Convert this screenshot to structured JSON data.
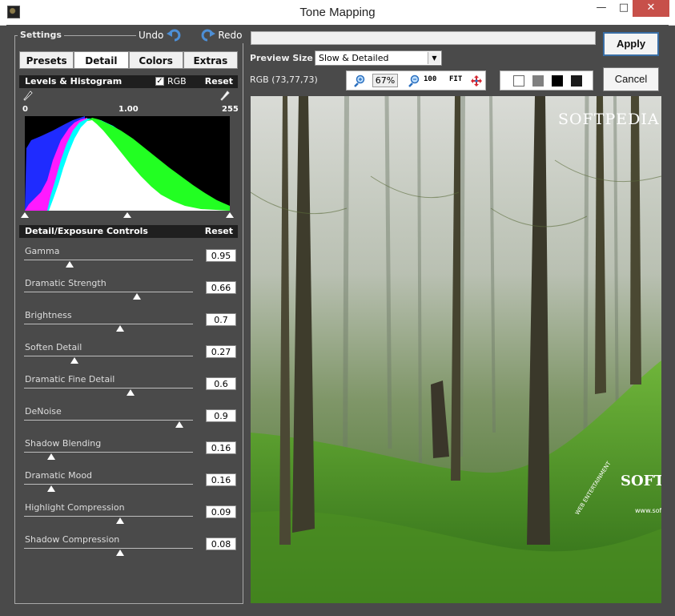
{
  "window": {
    "title": "Tone Mapping",
    "minimize": "—",
    "maximize": "□",
    "close": "✕"
  },
  "settings": {
    "label": "Settings",
    "undo": "Undo",
    "redo": "Redo",
    "tabs": [
      "Presets",
      "Detail",
      "Colors",
      "Extras"
    ],
    "active_tab": "Detail"
  },
  "levels": {
    "header": "Levels & Histogram",
    "rgb_label": "RGB",
    "rgb_checked": true,
    "reset": "Reset",
    "axis": [
      "0",
      "1.00",
      "255"
    ]
  },
  "detail": {
    "header": "Detail/Exposure Controls",
    "reset": "Reset",
    "controls": [
      {
        "label": "Gamma",
        "value": "0.95",
        "position": 0.27
      },
      {
        "label": "Dramatic Strength",
        "value": "0.66",
        "position": 0.67
      },
      {
        "label": "Brightness",
        "value": "0.7",
        "position": 0.57
      },
      {
        "label": "Soften Detail",
        "value": "0.27",
        "position": 0.3
      },
      {
        "label": "Dramatic Fine Detail",
        "value": "0.6",
        "position": 0.63
      },
      {
        "label": "DeNoise",
        "value": "0.9",
        "position": 0.92
      },
      {
        "label": "Shadow Blending",
        "value": "0.16",
        "position": 0.16
      },
      {
        "label": "Dramatic Mood",
        "value": "0.16",
        "position": 0.16
      },
      {
        "label": "Highlight Compression",
        "value": "0.09",
        "position": 0.57
      },
      {
        "label": "Shadow Compression",
        "value": "0.08",
        "position": 0.57
      }
    ]
  },
  "preview": {
    "size_label": "Preview Size",
    "size_value": "Slow & Detailed",
    "rgb_readout": "RGB (73,77,73)",
    "zoom": "67%",
    "zoom_100": "100",
    "zoom_fit": "FIT",
    "watermark_main": "SOFTPEDIA",
    "watermark_small": "SOFT",
    "watermark_url": "www.soft",
    "watermark_web": "WEB ENTERTAINMENT"
  },
  "buttons": {
    "apply": "Apply",
    "cancel": "Cancel"
  },
  "colors": {
    "panel": "#4a4a4a",
    "header": "#1f1f1f",
    "close": "#c7504a",
    "accent": "#3a6ea5"
  }
}
